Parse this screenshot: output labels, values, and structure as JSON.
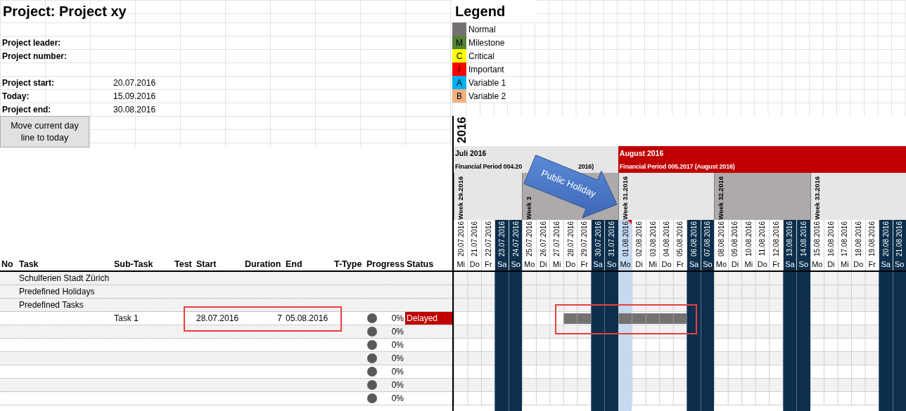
{
  "project": {
    "title": "Project: Project xy",
    "people": [
      {
        "label": "Project leader:"
      },
      {
        "label": "Project number:"
      }
    ],
    "dates": [
      {
        "label": "Project start:",
        "value": "20.07.2016"
      },
      {
        "label": "Today:",
        "value": "15.09.2016"
      },
      {
        "label": "Project end:",
        "value": "30.08.2016"
      }
    ],
    "button": "Move current day line to today"
  },
  "legend": {
    "title": "Legend",
    "items": [
      {
        "label": "Normal",
        "color": "#767171"
      },
      {
        "letter": "M",
        "label": "Milestone",
        "color": "#548235"
      },
      {
        "letter": "C",
        "label": "Critical",
        "color": "#ffff00"
      },
      {
        "letter": "I",
        "label": "Important",
        "color": "#ff0000"
      },
      {
        "letter": "A",
        "label": "Variable 1",
        "color": "#00b0f0"
      },
      {
        "letter": "B",
        "label": "Variable 2",
        "color": "#f4b183"
      }
    ]
  },
  "year": "2016",
  "months": [
    {
      "label": "Juli 2016",
      "period": "Financial Period 004.20",
      "period_tail": "2016)",
      "color": "#e7e6e6",
      "weeks": [
        {
          "label": "Week 29.2016",
          "color": "#e7e6e6",
          "days": [
            {
              "date": "20.07.2016",
              "day": "Mi",
              "kind": "weekday"
            },
            {
              "date": "21.07.2016",
              "day": "Do",
              "kind": "weekday"
            },
            {
              "date": "22.07.2016",
              "day": "Fr",
              "kind": "weekday"
            },
            {
              "date": "23.07.2016",
              "day": "Sa",
              "kind": "weekend"
            },
            {
              "date": "24.07.2016",
              "day": "So",
              "kind": "weekend"
            }
          ]
        },
        {
          "label": "Week 3",
          "color": "#aeaaaa",
          "days": [
            {
              "date": "25.07.2016",
              "day": "Mo",
              "kind": "weekday"
            },
            {
              "date": "26.07.2016",
              "day": "Di",
              "kind": "weekday"
            },
            {
              "date": "27.07.2016",
              "day": "Mi",
              "kind": "weekday"
            },
            {
              "date": "28.07.2016",
              "day": "Do",
              "kind": "weekday"
            },
            {
              "date": "29.07.2016",
              "day": "Fr",
              "kind": "weekday"
            },
            {
              "date": "30.07.2016",
              "day": "Sa",
              "kind": "weekend"
            },
            {
              "date": "31.07.2016",
              "day": "So",
              "kind": "weekend"
            }
          ]
        }
      ]
    },
    {
      "label": "August 2016",
      "period": "Financial Period 005.2017 (August 2016)",
      "color": "#c00000",
      "weeks": [
        {
          "label": "Week 31.2016",
          "color": "#e7e6e6",
          "days": [
            {
              "date": "01.08.2016",
              "day": "Mo",
              "kind": "holiday"
            },
            {
              "date": "02.08.2016",
              "day": "Di",
              "kind": "weekday"
            },
            {
              "date": "03.08.2016",
              "day": "Mi",
              "kind": "weekday"
            },
            {
              "date": "04.08.2016",
              "day": "Do",
              "kind": "weekday"
            },
            {
              "date": "05.08.2016",
              "day": "Fr",
              "kind": "weekday"
            },
            {
              "date": "06.08.2016",
              "day": "Sa",
              "kind": "weekend"
            },
            {
              "date": "07.08.2016",
              "day": "So",
              "kind": "weekend"
            }
          ]
        },
        {
          "label": "Week 32.2016",
          "color": "#aeaaaa",
          "days": [
            {
              "date": "08.08.2016",
              "day": "Mo",
              "kind": "weekday"
            },
            {
              "date": "09.08.2016",
              "day": "Di",
              "kind": "weekday"
            },
            {
              "date": "10.08.2016",
              "day": "Mi",
              "kind": "weekday"
            },
            {
              "date": "11.08.2016",
              "day": "Do",
              "kind": "weekday"
            },
            {
              "date": "12.08.2016",
              "day": "Fr",
              "kind": "weekday"
            },
            {
              "date": "13.08.2016",
              "day": "Sa",
              "kind": "weekend"
            },
            {
              "date": "14.08.2016",
              "day": "So",
              "kind": "weekend"
            }
          ]
        },
        {
          "label": "Week 33.2016",
          "color": "#e7e6e6",
          "days": [
            {
              "date": "15.08.2016",
              "day": "Mo",
              "kind": "weekday"
            },
            {
              "date": "16.08.2016",
              "day": "Di",
              "kind": "weekday"
            },
            {
              "date": "17.08.2016",
              "day": "Mi",
              "kind": "weekday"
            },
            {
              "date": "18.08.2016",
              "day": "Do",
              "kind": "weekday"
            },
            {
              "date": "19.08.2016",
              "day": "Fr",
              "kind": "weekday"
            },
            {
              "date": "20.08.2016",
              "day": "Sa",
              "kind": "weekend"
            },
            {
              "date": "21.08.2016",
              "day": "So",
              "kind": "weekend"
            }
          ]
        }
      ]
    }
  ],
  "callout": {
    "text": "Public Holiday"
  },
  "columns": [
    "No",
    "Task",
    "Sub-Task",
    "Test",
    "Start",
    "Duration",
    "End",
    "T-Type",
    "Progress",
    "Status"
  ],
  "rows": [
    {
      "kind": "group",
      "task": "Schulferien Stadt Zürich"
    },
    {
      "kind": "group",
      "task": "Predefined Holidays"
    },
    {
      "kind": "group",
      "task": "Predefined Tasks"
    },
    {
      "kind": "task",
      "subtask": "Task 1",
      "start": "28.07.2016",
      "duration": "7",
      "end": "05.08.2016",
      "progress": "0%",
      "status": "Delayed",
      "cells": [
        {
          "kind": "blank"
        },
        {
          "kind": "blank"
        },
        {
          "kind": "blank"
        },
        {
          "kind": "blank"
        },
        {
          "kind": "blank"
        },
        {
          "kind": "blank"
        },
        {
          "kind": "blank"
        },
        {
          "kind": "blank"
        },
        {
          "kind": "bar"
        },
        {
          "kind": "bar"
        },
        {
          "kind": "blank"
        },
        {
          "kind": "blank"
        },
        {
          "kind": "bar"
        },
        {
          "kind": "bar"
        },
        {
          "kind": "bar"
        },
        {
          "kind": "bar"
        },
        {
          "kind": "bar"
        },
        {
          "kind": "blank"
        },
        {
          "kind": "blank"
        },
        {
          "kind": "blank"
        },
        {
          "kind": "blank"
        },
        {
          "kind": "blank"
        },
        {
          "kind": "blank"
        },
        {
          "kind": "blank"
        },
        {
          "kind": "blank"
        },
        {
          "kind": "blank"
        },
        {
          "kind": "blank"
        },
        {
          "kind": "blank"
        },
        {
          "kind": "blank"
        },
        {
          "kind": "blank"
        },
        {
          "kind": "blank"
        },
        {
          "kind": "blank"
        },
        {
          "kind": "blank"
        }
      ]
    },
    {
      "kind": "empty",
      "progress": "0%"
    },
    {
      "kind": "empty",
      "progress": "0%"
    },
    {
      "kind": "empty",
      "progress": "0%"
    },
    {
      "kind": "empty",
      "progress": "0%"
    },
    {
      "kind": "empty",
      "progress": "0%"
    },
    {
      "kind": "empty",
      "progress": "0%"
    }
  ]
}
